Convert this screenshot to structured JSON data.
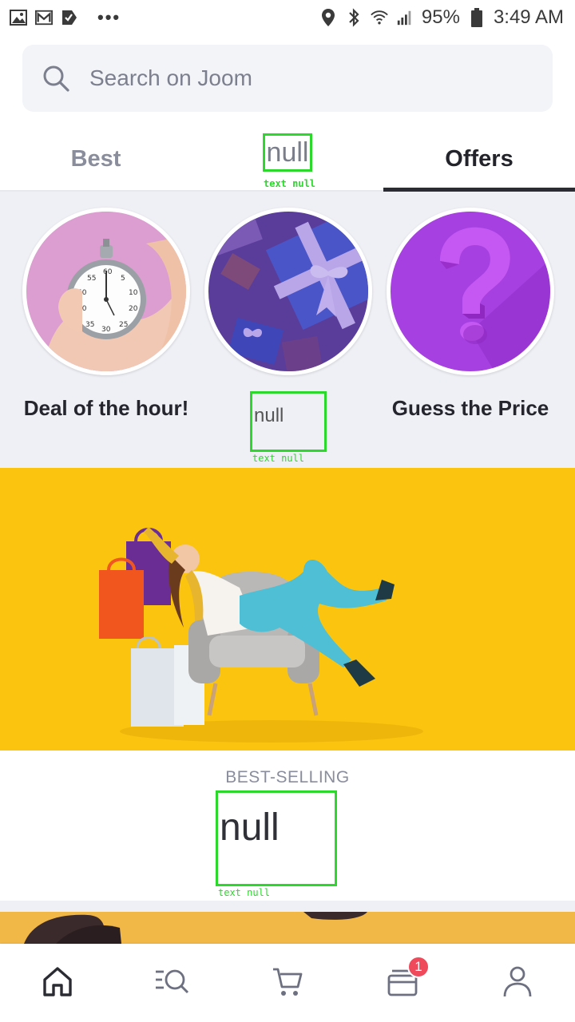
{
  "status_bar": {
    "battery": "95%",
    "time": "3:49 AM",
    "more_dots": "•••",
    "icons": [
      "gallery-icon",
      "gmail-icon",
      "tasks-icon",
      "location-icon",
      "bluetooth-icon",
      "wifi-icon",
      "signal-icon",
      "battery-icon"
    ]
  },
  "search": {
    "placeholder": "Search on Joom"
  },
  "tabs": [
    {
      "label": "Best",
      "active": false
    },
    {
      "label": "null",
      "active": false
    },
    {
      "label": "Offers",
      "active": true
    }
  ],
  "offers": [
    {
      "label": "Deal of the hour!",
      "image": "stopwatch-image"
    },
    {
      "label": "null",
      "image": "gift-box-image"
    },
    {
      "label": "Guess the Price",
      "image": "question-mark-image"
    }
  ],
  "debug_overlay": {
    "tag": "text null"
  },
  "banner": {
    "image": "shopping-woman-armchair-banner",
    "color": "#fac40f"
  },
  "best_selling": {
    "label": "BEST-SELLING",
    "title": "null"
  },
  "bottom_nav": {
    "items": [
      "home-icon",
      "catalog-search-icon",
      "cart-icon",
      "orders-icon",
      "profile-icon"
    ],
    "orders_badge": "1"
  },
  "colors": {
    "accent_dark": "#2a2b33",
    "badge_red": "#ef4a5c",
    "banner_yellow": "#fac40f",
    "section_bg": "#eff0f6"
  }
}
